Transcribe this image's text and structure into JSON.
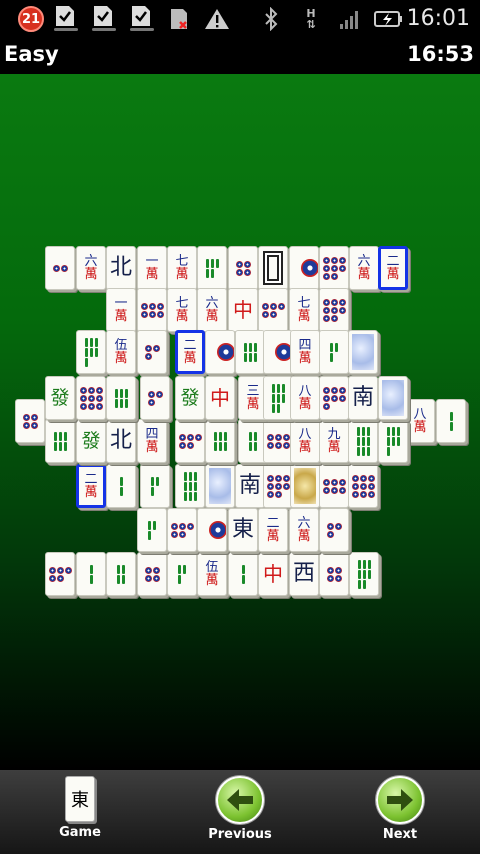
{
  "status_bar": {
    "notification_count": "21",
    "time": "16:01",
    "icons": [
      "notification-badge-icon",
      "task-done-icon",
      "task-done-icon",
      "task-done-icon",
      "sd-card-error-icon",
      "warning-icon",
      "bluetooth-icon",
      "hspa-data-icon",
      "signal-icon",
      "battery-charging-icon"
    ]
  },
  "game": {
    "level": "Easy",
    "timer": "16:53"
  },
  "tiles": [
    {
      "k": "dots",
      "n": 2
    },
    {
      "k": "char",
      "t": "六"
    },
    {
      "k": "wind",
      "t": "北"
    },
    {
      "k": "char",
      "t": "一"
    },
    {
      "k": "char",
      "t": "七"
    },
    {
      "k": "bam",
      "n": 5
    },
    {
      "k": "dots",
      "n": 4
    },
    {
      "k": "white",
      "t": "white-dragon"
    },
    {
      "k": "dots",
      "n": 1
    },
    {
      "k": "dots",
      "n": 8
    },
    {
      "k": "char",
      "t": "六"
    },
    {
      "k": "char",
      "t": "二",
      "sel": true
    },
    {
      "k": "char",
      "t": "一"
    },
    {
      "k": "dots",
      "n": 6
    },
    {
      "k": "char",
      "t": "七"
    },
    {
      "k": "char",
      "t": "六"
    },
    {
      "k": "red",
      "t": "中"
    },
    {
      "k": "dots",
      "n": 5
    },
    {
      "k": "char",
      "t": "七"
    },
    {
      "k": "dots",
      "n": 8
    },
    {
      "k": "bam",
      "n": 7
    },
    {
      "k": "char",
      "t": "伍"
    },
    {
      "k": "dots",
      "n": 3
    },
    {
      "k": "char",
      "t": "二",
      "sel": true
    },
    {
      "k": "dots",
      "n": 1
    },
    {
      "k": "bam",
      "n": 6
    },
    {
      "k": "dots",
      "n": 1
    },
    {
      "k": "char",
      "t": "四"
    },
    {
      "k": "bam",
      "n": 3
    },
    {
      "k": "flower",
      "t": "flower"
    },
    {
      "k": "green",
      "t": "發"
    },
    {
      "k": "dots",
      "n": 9
    },
    {
      "k": "bam",
      "n": 6
    },
    {
      "k": "dots",
      "n": 3
    },
    {
      "k": "green",
      "t": "發"
    },
    {
      "k": "red",
      "t": "中"
    },
    {
      "k": "char",
      "t": "三"
    },
    {
      "k": "bam",
      "n": 8
    },
    {
      "k": "char",
      "t": "八"
    },
    {
      "k": "dots",
      "n": 7
    },
    {
      "k": "wind",
      "t": "南"
    },
    {
      "k": "flower",
      "t": "flower"
    },
    {
      "k": "dots",
      "n": 4
    },
    {
      "k": "char",
      "t": "八"
    },
    {
      "k": "bam",
      "n": 2
    },
    {
      "k": "bam",
      "n": 6
    },
    {
      "k": "green",
      "t": "發"
    },
    {
      "k": "wind",
      "t": "北"
    },
    {
      "k": "char",
      "t": "四"
    },
    {
      "k": "dots",
      "n": 5
    },
    {
      "k": "bam",
      "n": 6
    },
    {
      "k": "bam",
      "n": 4
    },
    {
      "k": "dots",
      "n": 6
    },
    {
      "k": "char",
      "t": "八"
    },
    {
      "k": "char",
      "t": "九"
    },
    {
      "k": "bam",
      "n": 9
    },
    {
      "k": "bam",
      "n": 7
    },
    {
      "k": "char",
      "t": "二",
      "sel": true
    },
    {
      "k": "bam",
      "n": 2
    },
    {
      "k": "bam",
      "n": 3
    },
    {
      "k": "bam",
      "n": 9
    },
    {
      "k": "flower",
      "t": "flower"
    },
    {
      "k": "wind",
      "t": "南"
    },
    {
      "k": "dots",
      "n": 8
    },
    {
      "k": "flower",
      "t": "flower"
    },
    {
      "k": "dots",
      "n": 6
    },
    {
      "k": "dots",
      "n": 9
    },
    {
      "k": "bam",
      "n": 3
    },
    {
      "k": "dots",
      "n": 5
    },
    {
      "k": "dots",
      "n": 1
    },
    {
      "k": "wind",
      "t": "東"
    },
    {
      "k": "char",
      "t": "二"
    },
    {
      "k": "char",
      "t": "六"
    },
    {
      "k": "dots",
      "n": 3
    },
    {
      "k": "dots",
      "n": 5
    },
    {
      "k": "bam",
      "n": 2
    },
    {
      "k": "bam",
      "n": 4
    },
    {
      "k": "dots",
      "n": 4
    },
    {
      "k": "bam",
      "n": 3
    },
    {
      "k": "char",
      "t": "伍"
    },
    {
      "k": "bam",
      "n": 2
    },
    {
      "k": "red",
      "t": "中"
    },
    {
      "k": "wind",
      "t": "西"
    },
    {
      "k": "dots",
      "n": 4
    },
    {
      "k": "bam",
      "n": 8
    }
  ],
  "toolbar": {
    "game_label": "Game",
    "game_icon_glyph": "東",
    "previous_label": "Previous",
    "next_label": "Next"
  },
  "colors": {
    "selection": "#1433e6",
    "felt_top": "#0a7a10",
    "felt_bottom": "#000000"
  }
}
